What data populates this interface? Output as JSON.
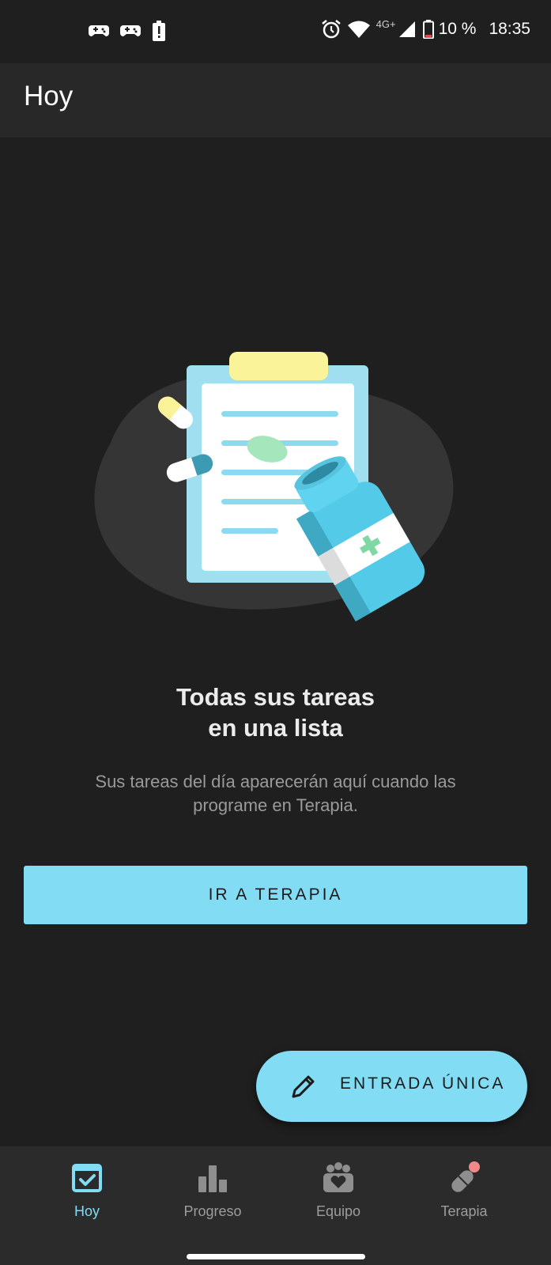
{
  "status_bar": {
    "left_icons": [
      "game-controller-icon",
      "game-controller-icon",
      "battery-alert-icon"
    ],
    "network": "4G+",
    "battery": "10 %",
    "time": "18:35"
  },
  "app_bar": {
    "title": "Hoy"
  },
  "empty_state": {
    "title_line1": "Todas sus tareas",
    "title_line2": "en una lista",
    "subtitle_line1": "Sus tareas del día aparecerán aquí cuando las",
    "subtitle_line2": "programe en Terapia."
  },
  "primary_button": {
    "label": "IR A TERAPIA"
  },
  "fab": {
    "label": "ENTRADA ÚNICA",
    "icon": "pencil-icon"
  },
  "bottom_nav": {
    "items": [
      {
        "label": "Hoy",
        "icon": "calendar-check-icon",
        "active": true
      },
      {
        "label": "Progreso",
        "icon": "bar-chart-icon",
        "active": false
      },
      {
        "label": "Equipo",
        "icon": "team-heart-icon",
        "active": false
      },
      {
        "label": "Terapia",
        "icon": "pill-icon",
        "active": false
      }
    ]
  },
  "colors": {
    "accent": "#82dcf3",
    "background": "#1f1f1f",
    "app_bar": "#282828",
    "nav_bar": "#2b2b2b",
    "notification_dot": "#f08a8a"
  }
}
